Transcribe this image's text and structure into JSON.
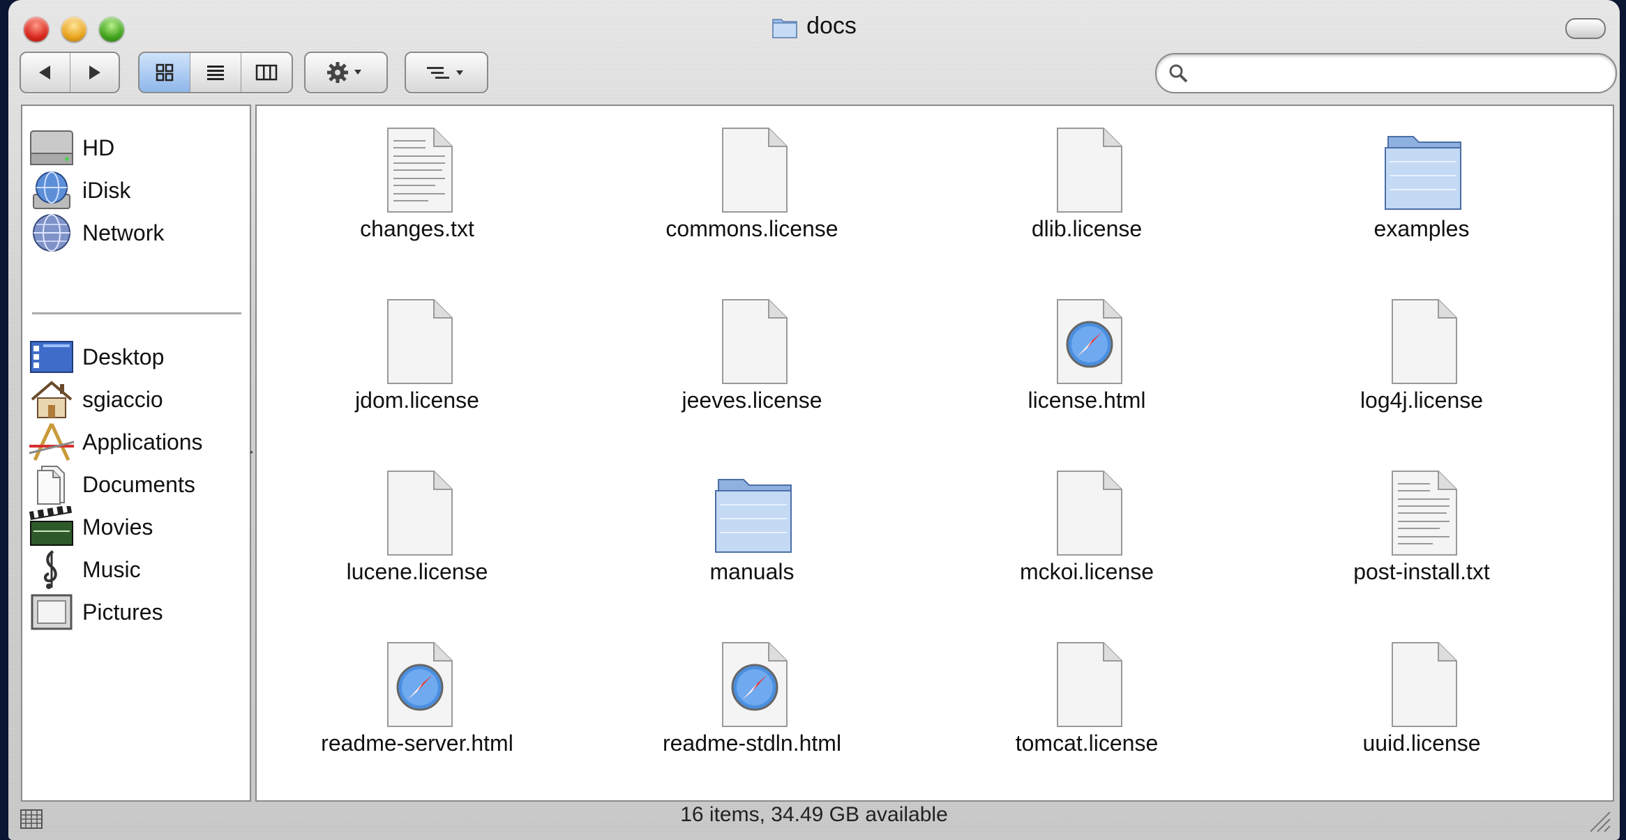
{
  "window": {
    "title": "docs"
  },
  "toolbar": {
    "back_icon": "back-arrow-icon",
    "forward_icon": "forward-arrow-icon",
    "view_modes": [
      "icon-view-icon",
      "list-view-icon",
      "column-view-icon"
    ],
    "active_view": "icon-view-icon",
    "action_icon": "gear-icon",
    "arrange_icon": "arrange-icon"
  },
  "search": {
    "placeholder": "",
    "value": ""
  },
  "sidebar": {
    "devices": [
      {
        "label": "HD",
        "icon": "hard-drive-icon"
      },
      {
        "label": "iDisk",
        "icon": "idisk-icon"
      },
      {
        "label": "Network",
        "icon": "network-globe-icon"
      }
    ],
    "places": [
      {
        "label": "Desktop",
        "icon": "desktop-icon"
      },
      {
        "label": "sgiaccio",
        "icon": "home-icon"
      },
      {
        "label": "Applications",
        "icon": "applications-icon"
      },
      {
        "label": "Documents",
        "icon": "documents-icon"
      },
      {
        "label": "Movies",
        "icon": "movies-clapper-icon"
      },
      {
        "label": "Music",
        "icon": "music-clef-icon"
      },
      {
        "label": "Pictures",
        "icon": "pictures-frame-icon"
      }
    ]
  },
  "files": [
    {
      "name": "changes.txt",
      "type": "text"
    },
    {
      "name": "commons.license",
      "type": "doc"
    },
    {
      "name": "dlib.license",
      "type": "doc"
    },
    {
      "name": "examples",
      "type": "folder"
    },
    {
      "name": "jdom.license",
      "type": "doc"
    },
    {
      "name": "jeeves.license",
      "type": "doc"
    },
    {
      "name": "license.html",
      "type": "html"
    },
    {
      "name": "log4j.license",
      "type": "doc"
    },
    {
      "name": "lucene.license",
      "type": "doc"
    },
    {
      "name": "manuals",
      "type": "folder"
    },
    {
      "name": "mckoi.license",
      "type": "doc"
    },
    {
      "name": "post-install.txt",
      "type": "text"
    },
    {
      "name": "readme-server.html",
      "type": "html"
    },
    {
      "name": "readme-stdln.html",
      "type": "html"
    },
    {
      "name": "tomcat.license",
      "type": "doc"
    },
    {
      "name": "uuid.license",
      "type": "doc"
    }
  ],
  "status": {
    "text": "16 items, 34.49 GB available"
  }
}
